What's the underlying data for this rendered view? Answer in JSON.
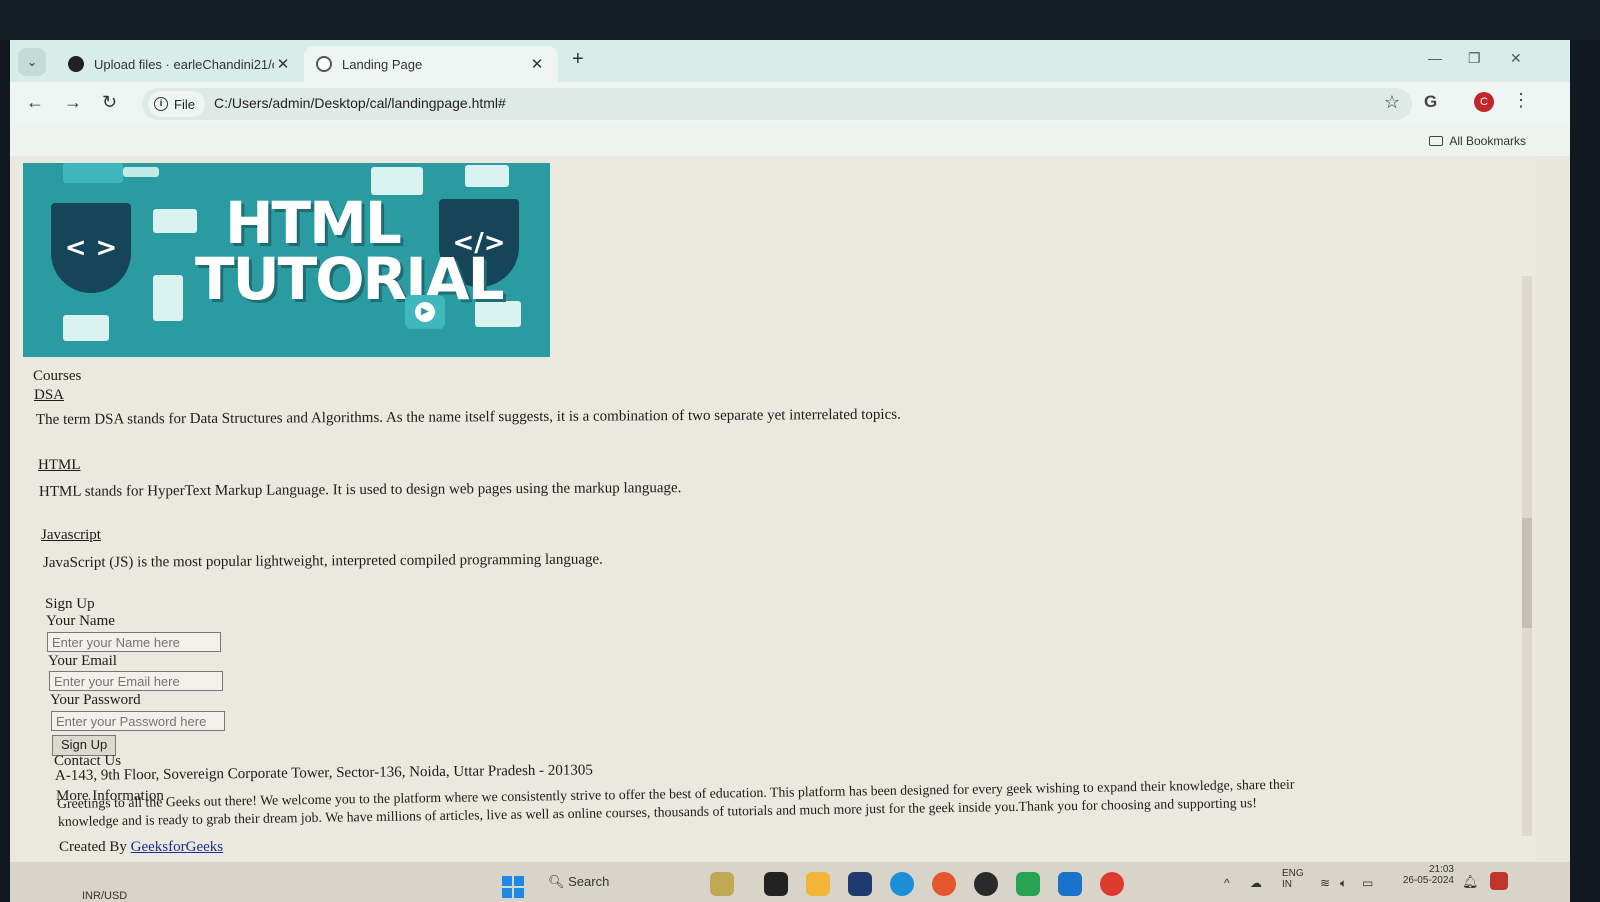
{
  "browser": {
    "tabs": [
      {
        "title": "Upload files · earleChandini21/c",
        "active": false
      },
      {
        "title": "Landing Page",
        "active": true
      }
    ],
    "new_tab": "+",
    "address": {
      "chip_label": "File",
      "url": "C:/Users/admin/Desktop/cal/landingpage.html#"
    },
    "profile_initial": "C",
    "google_icon_label": "G",
    "bookmarks_label": "All Bookmarks"
  },
  "page": {
    "banner": {
      "line1": "HTML",
      "line2": "TUTORIAL",
      "left_code": "< >",
      "right_code": "</>"
    },
    "courses_heading": "Courses",
    "courses": [
      {
        "name": "DSA",
        "description": "The term DSA stands for Data Structures and Algorithms. As the name itself suggests, it is a combination of two separate yet interrelated topics."
      },
      {
        "name": "HTML",
        "description": "HTML stands for HyperText Markup Language. It is used to design web pages using the markup language."
      },
      {
        "name": "Javascript",
        "description": "JavaScript (JS) is the most popular lightweight, interpreted compiled programming language."
      }
    ],
    "signup": {
      "heading": "Sign Up",
      "name_label": "Your Name",
      "name_placeholder": "Enter your Name here",
      "email_label": "Your Email",
      "email_placeholder": "Enter your Email here",
      "password_label": "Your Password",
      "password_placeholder": "Enter your Password here",
      "button": "Sign Up"
    },
    "contact": {
      "heading": "Contact Us",
      "address": "A-143, 9th Floor, Sovereign Corporate Tower, Sector-136, Noida, Uttar Pradesh - 201305"
    },
    "more_info": {
      "heading": "More Information",
      "line1": "Greetings to all the Geeks out there! We welcome you to the platform where we consistently strive to offer the best of education. This platform has been designed for every geek wishing to expand their knowledge, share their",
      "line2": "knowledge and is ready to grab their dream job. We have millions of articles, live as well as online courses, thousands of tutorials and much more just for the geek inside you.Thank you for choosing and supporting us!"
    },
    "footer": {
      "created_by": "Created By",
      "link": "GeeksforGeeks"
    }
  },
  "taskbar": {
    "search_label": "Search",
    "ticker": "INR/USD",
    "lang_line1": "ENG",
    "lang_line2": "IN",
    "time": "21:03",
    "date": "26-05-2024"
  }
}
